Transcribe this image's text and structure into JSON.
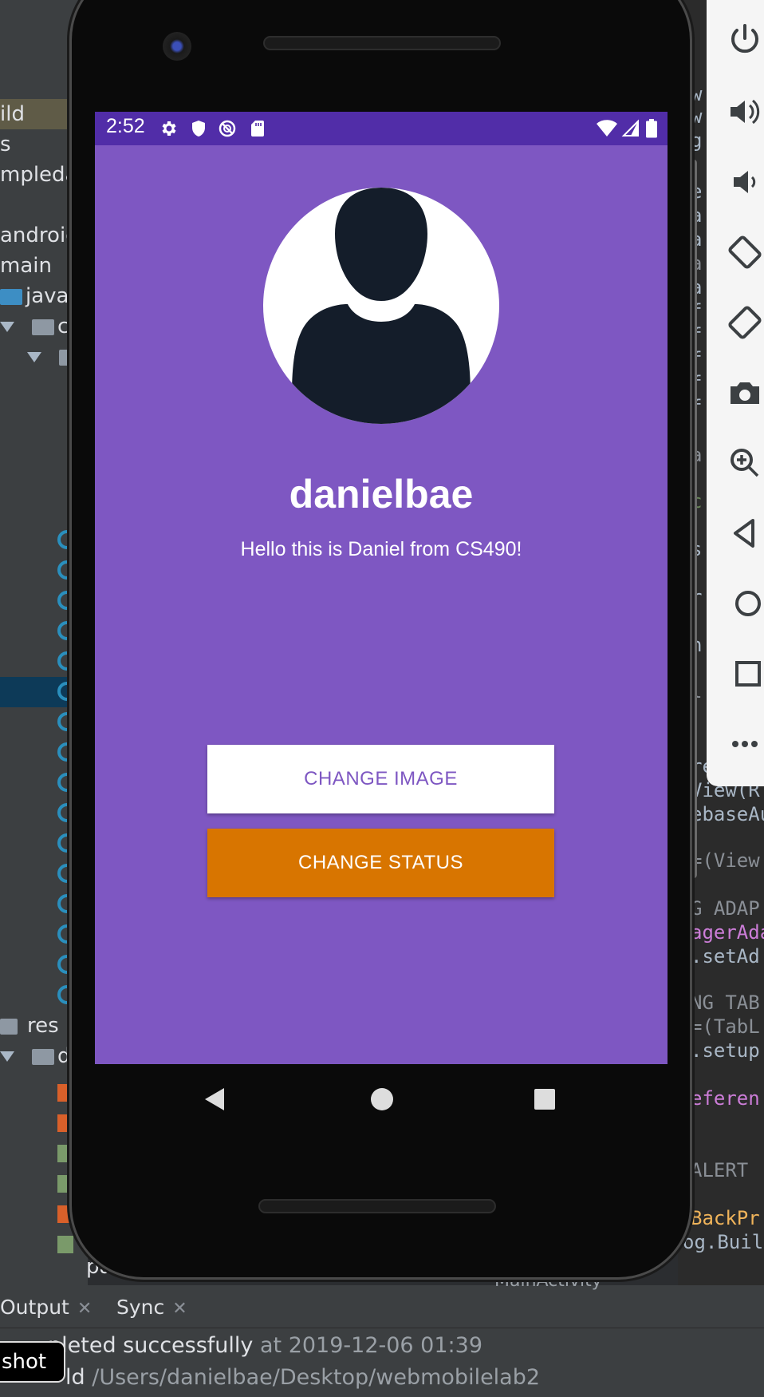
{
  "ide": {
    "breadcrumb_fragment": "ma",
    "project_tree": [
      {
        "text": "ild"
      },
      {
        "text": "s"
      },
      {
        "text": "mpledat"
      },
      {
        "text": "androic"
      },
      {
        "text": "main"
      },
      {
        "text": "java"
      },
      {
        "text": "c"
      },
      {
        "text": "res"
      },
      {
        "text": "d"
      },
      {
        "text": "pa"
      }
    ],
    "code_fragments": [
      "w",
      "w",
      "g",
      "e.",
      "a",
      "a",
      "a",
      "a",
      "f",
      "f",
      "f",
      "f",
      "f",
      "a",
      "c",
      "s",
      "r",
      "n",
      "l",
      "re",
      "View(R",
      "ebaseAu",
      "=(View",
      "G ADAP",
      "agerAda",
      ".setAd",
      "NG TAB",
      "=(TabL",
      ".setup",
      "eferen",
      "ALERT",
      "BackPr",
      "og.Buil"
    ],
    "editor_tab_label": "MainActivity",
    "bottom_tabs": [
      {
        "label": "Output"
      },
      {
        "label": "Sync"
      }
    ],
    "console": {
      "line1_main": "pleted successfully",
      "line1_time": " at 2019-12-06 01:39",
      "line2_prefix": "ld",
      "line2_path": " /Users/danielbae/Desktop/webmobilelab2"
    },
    "tooltip": "shot"
  },
  "phone": {
    "status_bar": {
      "time": "2:52",
      "left_icons": [
        "settings-icon",
        "shield-icon",
        "do-not-disturb-icon",
        "sd-card-icon"
      ],
      "right_icons": [
        "wifi-icon",
        "signal-icon",
        "battery-icon"
      ]
    },
    "profile": {
      "username": "danielbae",
      "status": "Hello this is Daniel from CS490!"
    },
    "buttons": {
      "change_image": "CHANGE IMAGE",
      "change_status": "CHANGE STATUS"
    },
    "colors": {
      "primary": "#7e57c2",
      "primary_dark": "#512da8",
      "accent": "#d87500"
    }
  },
  "emulator_toolbar": [
    "power-icon",
    "volume-up-icon",
    "volume-down-icon",
    "rotate-left-icon",
    "rotate-right-icon",
    "camera-icon",
    "zoom-icon",
    "back-icon",
    "home-icon",
    "overview-icon",
    "more-icon"
  ]
}
